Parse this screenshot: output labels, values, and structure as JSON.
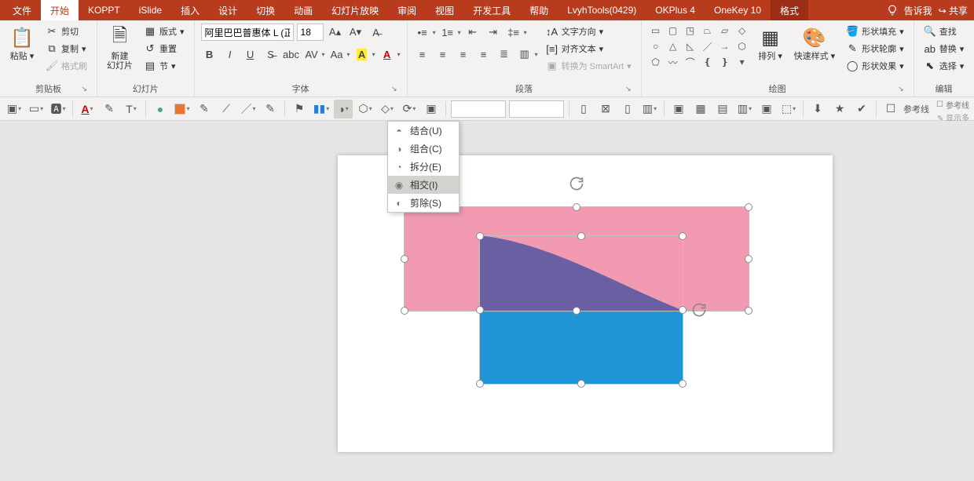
{
  "tabs": {
    "file": "文件",
    "home": "开始",
    "koppt": "KOPPT",
    "islide": "iSlide",
    "insert": "插入",
    "design": "设计",
    "transitions": "切换",
    "animations": "动画",
    "slideshow": "幻灯片放映",
    "review": "审阅",
    "view": "视图",
    "devtools": "开发工具",
    "help": "帮助",
    "lvyh": "LvyhTools(0429)",
    "okplus": "OKPlus 4",
    "onekey": "OneKey 10",
    "format": "格式",
    "tellme": "告诉我",
    "share": "共享"
  },
  "groups": {
    "clipboard": {
      "label": "剪贴板",
      "paste": "粘贴",
      "cut": "剪切",
      "copy": "复制",
      "fmtpainter": "格式刷"
    },
    "slides": {
      "label": "幻灯片",
      "new": "新建\n幻灯片",
      "layout": "版式",
      "reset": "重置",
      "section": "节"
    },
    "font": {
      "label": "字体",
      "fontname": "阿里巴巴普惠体 L (正",
      "fontsize": "18"
    },
    "paragraph": {
      "label": "段落",
      "textdir": "文字方向",
      "align": "对齐文本",
      "smartart": "转换为 SmartArt"
    },
    "drawing": {
      "label": "绘图",
      "arrange": "排列",
      "quickstyles": "快速样式",
      "fill": "形状填充",
      "outline": "形状轮廓",
      "effects": "形状效果"
    },
    "editing": {
      "label": "编辑",
      "find": "查找",
      "replace": "替换",
      "select": "选择"
    }
  },
  "toolbar2": {
    "guides_label": "参考线",
    "more_label": "显示多"
  },
  "dropdown": {
    "union": "结合(U)",
    "combine": "组合(C)",
    "fragment": "拆分(E)",
    "intersect": "相交(I)",
    "subtract": "剪除(S)"
  }
}
